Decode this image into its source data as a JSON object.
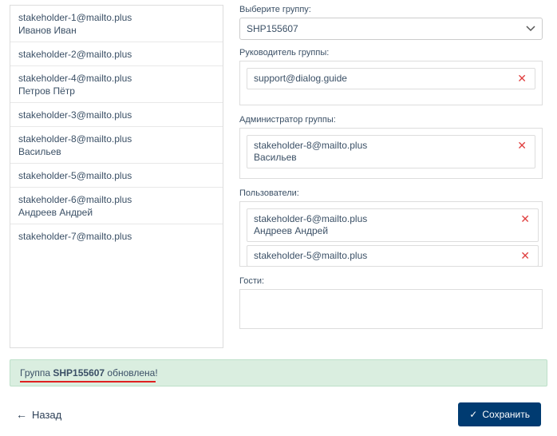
{
  "labels": {
    "select_group": "Выберите группу:",
    "group_leader": "Руководитель группы:",
    "group_admin": "Администратор группы:",
    "users": "Пользователи:",
    "guests": "Гости:"
  },
  "group_selected": "SHP155607",
  "stakeholders": [
    {
      "email": "stakeholder-1@mailto.plus",
      "name": "Иванов Иван"
    },
    {
      "email": "stakeholder-2@mailto.plus",
      "name": ""
    },
    {
      "email": "stakeholder-4@mailto.plus",
      "name": "Петров Пётр"
    },
    {
      "email": "stakeholder-3@mailto.plus",
      "name": ""
    },
    {
      "email": "stakeholder-8@mailto.plus",
      "name": "Васильев"
    },
    {
      "email": "stakeholder-5@mailto.plus",
      "name": ""
    },
    {
      "email": "stakeholder-6@mailto.plus",
      "name": "Андреев Андрей"
    },
    {
      "email": "stakeholder-7@mailto.plus",
      "name": ""
    }
  ],
  "leader": {
    "email": "support@dialog.guide",
    "name": ""
  },
  "admin": {
    "email": "stakeholder-8@mailto.plus",
    "name": "Васильев"
  },
  "users": [
    {
      "email": "stakeholder-6@mailto.plus",
      "name": "Андреев Андрей"
    },
    {
      "email": "stakeholder-5@mailto.plus",
      "name": ""
    }
  ],
  "notification": {
    "prefix": "Группа ",
    "group": "SHP155607",
    "suffix": " обновлена!"
  },
  "buttons": {
    "back": "Назад",
    "save": "Сохранить"
  }
}
